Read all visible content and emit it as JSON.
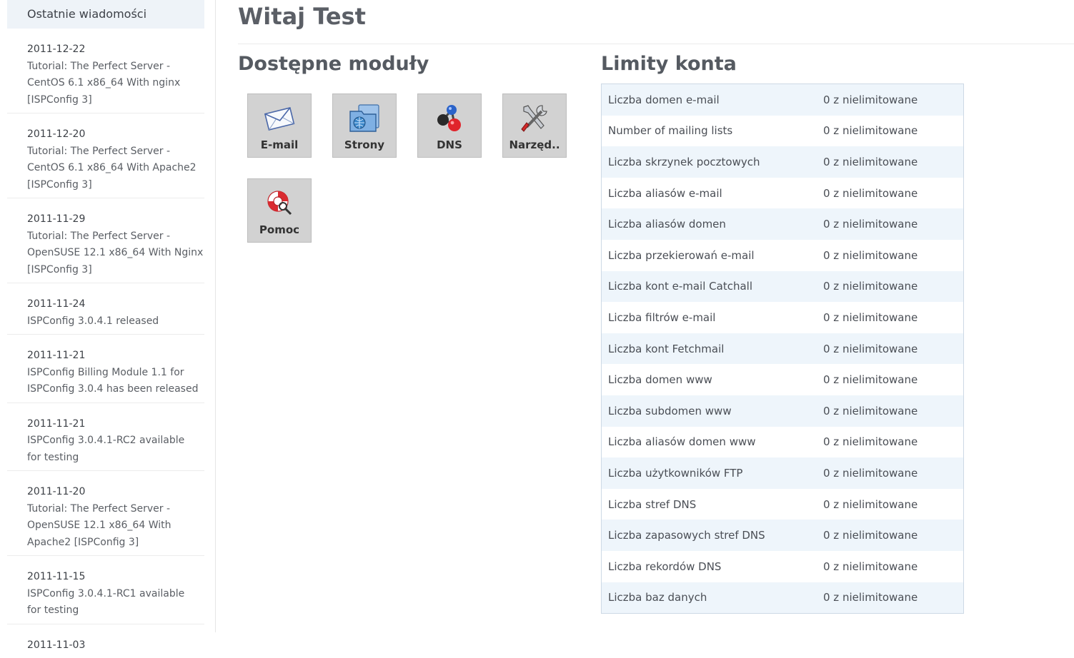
{
  "sidebar": {
    "header": "Ostatnie wiadomości",
    "news": [
      {
        "date": "2011-12-22",
        "lines": [
          "Tutorial: The Perfect Server -",
          "CentOS 6.1 x86_64 With nginx",
          "[ISPConfig 3]"
        ]
      },
      {
        "date": "2011-12-20",
        "lines": [
          "Tutorial: The Perfect Server -",
          "CentOS 6.1 x86_64 With Apache2",
          "[ISPConfig 3]"
        ]
      },
      {
        "date": "2011-11-29",
        "lines": [
          "Tutorial: The Perfect Server -",
          "OpenSUSE 12.1 x86_64 With Nginx",
          "[ISPConfig 3]"
        ]
      },
      {
        "date": "2011-11-24",
        "lines": [
          "ISPConfig 3.0.4.1 released"
        ]
      },
      {
        "date": "2011-11-21",
        "lines": [
          "ISPConfig Billing Module 1.1 for",
          "ISPConfig 3.0.4 has been released"
        ]
      },
      {
        "date": "2011-11-21",
        "lines": [
          "ISPConfig 3.0.4.1-RC2 available",
          "for testing"
        ]
      },
      {
        "date": "2011-11-20",
        "lines": [
          "Tutorial: The Perfect Server -",
          "OpenSUSE 12.1 x86_64 With",
          "Apache2 [ISPConfig 3]"
        ]
      },
      {
        "date": "2011-11-15",
        "lines": [
          "ISPConfig 3.0.4.1-RC1 available",
          "for testing"
        ]
      },
      {
        "date": "2011-11-03",
        "lines": []
      }
    ]
  },
  "main": {
    "title": "Witaj Test",
    "modules_title": "Dostępne moduły",
    "modules": [
      {
        "label": "E-mail",
        "icon": "envelope-icon"
      },
      {
        "label": "Strony",
        "icon": "websites-icon"
      },
      {
        "label": "DNS",
        "icon": "dns-molecule-icon"
      },
      {
        "label": "Narzęd..",
        "icon": "tools-icon"
      },
      {
        "label": "Pomoc",
        "icon": "lifebuoy-icon"
      }
    ],
    "limits_title": "Limity konta",
    "limits": [
      {
        "name": "Liczba domen e-mail",
        "value": "0 z nielimitowane"
      },
      {
        "name": "Number of mailing lists",
        "value": "0 z nielimitowane"
      },
      {
        "name": "Liczba skrzynek pocztowych",
        "value": "0 z nielimitowane"
      },
      {
        "name": "Liczba aliasów e-mail",
        "value": "0 z nielimitowane"
      },
      {
        "name": "Liczba aliasów domen",
        "value": "0 z nielimitowane"
      },
      {
        "name": "Liczba przekierowań e-mail",
        "value": "0 z nielimitowane"
      },
      {
        "name": "Liczba kont e-mail Catchall",
        "value": "0 z nielimitowane"
      },
      {
        "name": "Liczba filtrów e-mail",
        "value": "0 z nielimitowane"
      },
      {
        "name": "Liczba kont Fetchmail",
        "value": "0 z nielimitowane"
      },
      {
        "name": "Liczba domen www",
        "value": "0 z nielimitowane"
      },
      {
        "name": "Liczba subdomen www",
        "value": "0 z nielimitowane"
      },
      {
        "name": "Liczba aliasów domen www",
        "value": "0 z nielimitowane"
      },
      {
        "name": "Liczba użytkowników FTP",
        "value": "0 z nielimitowane"
      },
      {
        "name": "Liczba stref DNS",
        "value": "0 z nielimitowane"
      },
      {
        "name": "Liczba zapasowych stref DNS",
        "value": "0 z nielimitowane"
      },
      {
        "name": "Liczba rekordów DNS",
        "value": "0 z nielimitowane"
      },
      {
        "name": "Liczba baz danych",
        "value": "0 z nielimitowane"
      }
    ]
  }
}
